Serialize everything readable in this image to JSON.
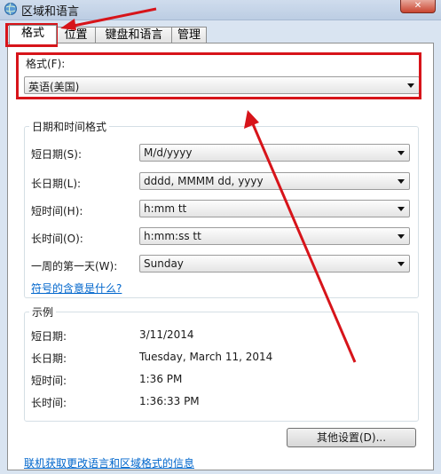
{
  "window": {
    "title": "区域和语言",
    "icon": "globe-icon",
    "close_label": "✕"
  },
  "tabs": [
    {
      "label": "格式",
      "active": true
    },
    {
      "label": "位置",
      "active": false
    },
    {
      "label": "键盘和语言",
      "active": false
    },
    {
      "label": "管理",
      "active": false
    }
  ],
  "format": {
    "label": "格式(F):",
    "value": "英语(美国)"
  },
  "datetime": {
    "legend": "日期和时间格式",
    "rows": [
      {
        "label": "短日期(S):",
        "value": "M/d/yyyy"
      },
      {
        "label": "长日期(L):",
        "value": "dddd, MMMM dd, yyyy"
      },
      {
        "label": "短时间(H):",
        "value": "h:mm tt"
      },
      {
        "label": "长时间(O):",
        "value": "h:mm:ss tt"
      },
      {
        "label": "一周的第一天(W):",
        "value": "Sunday"
      }
    ],
    "notation_link": "符号的含意是什么?"
  },
  "examples": {
    "legend": "示例",
    "rows": [
      {
        "label": "短日期:",
        "value": "3/11/2014"
      },
      {
        "label": "长日期:",
        "value": "Tuesday, March 11, 2014"
      },
      {
        "label": "短时间:",
        "value": "1:36 PM"
      },
      {
        "label": "长时间:",
        "value": "1:36:33 PM"
      }
    ]
  },
  "other_settings_button": "其他设置(D)...",
  "online_link": "联机获取更改语言和区域格式的信息",
  "colors": {
    "highlight": "#d7141a",
    "link": "#0066cc"
  }
}
